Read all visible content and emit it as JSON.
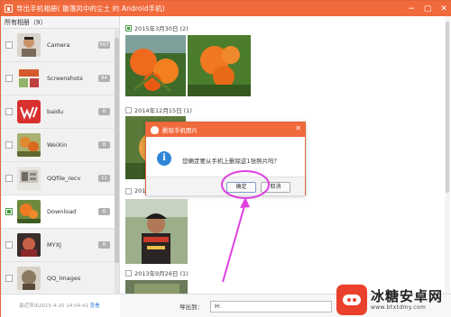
{
  "window": {
    "title": "导出手机相册( 散落风中的尘土 的 Android手机)",
    "controls": [
      "−",
      "▢",
      "✕"
    ]
  },
  "sidebar": {
    "header": "所有相册（9）",
    "albums": [
      {
        "name": "Camera",
        "count": "567",
        "selected": false
      },
      {
        "name": "Screenshots",
        "count": "84",
        "selected": false
      },
      {
        "name": "baidu",
        "count": "6",
        "selected": false
      },
      {
        "name": "WeiXin",
        "count": "8",
        "selected": false
      },
      {
        "name": "QQfile_recv",
        "count": "11",
        "selected": false
      },
      {
        "name": "Download",
        "count": "6",
        "selected": true
      },
      {
        "name": "MYXJ",
        "count": "6",
        "selected": false
      },
      {
        "name": "QQ_Images",
        "count": "",
        "selected": false
      }
    ],
    "footer_text": "最近导出2015-4-20 14:04:41",
    "footer_link": "查看"
  },
  "content": {
    "sections": [
      {
        "label": "2015年3月30日 (2)",
        "checked": true
      },
      {
        "label": "2014年12月15日 (1)",
        "checked": false
      },
      {
        "label": "2014",
        "checked": false
      },
      {
        "label": "2013年9月26日 (1)",
        "checked": false
      }
    ]
  },
  "bottom": {
    "export_label": "导出到：",
    "export_path": "H:"
  },
  "dialog": {
    "title": "删除手机图片",
    "message": "您确定要从手机上删除这1张照片吗？",
    "info_glyph": "i",
    "ok_label": "确定",
    "cancel_label": "取消",
    "close_glyph": "✕"
  },
  "watermark": {
    "title": "冰糖安卓网",
    "url": "www.btxtdmy.com"
  },
  "colors": {
    "accent": "#f16a3c",
    "annotation": "#e040e0",
    "info": "#2f86d6"
  }
}
